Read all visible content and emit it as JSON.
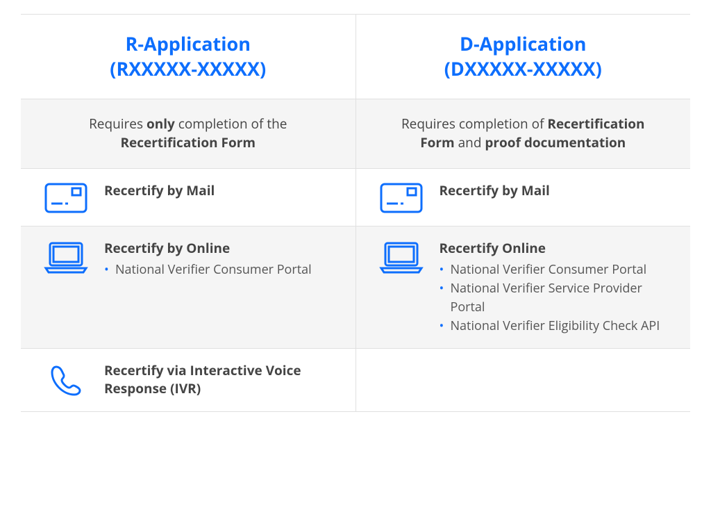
{
  "columns": {
    "left": {
      "title_line1": "R-Application",
      "title_line2": "(RXXXXX-XXXXX)",
      "desc_pre": "Requires ",
      "desc_bold1": "only",
      "desc_mid": " completion of the ",
      "desc_bold2": "Recertification Form",
      "desc_post": ""
    },
    "right": {
      "title_line1": "D-Application",
      "title_line2": "(DXXXXX-XXXXX)",
      "desc_pre": "Requires completion of ",
      "desc_bold1": "Recertification Form",
      "desc_mid": " and ",
      "desc_bold2": "proof documentation",
      "desc_post": ""
    }
  },
  "rows": [
    {
      "left": {
        "icon": "mail",
        "title": "Recertify by Mail",
        "items": []
      },
      "right": {
        "icon": "mail",
        "title": "Recertify by Mail",
        "items": []
      }
    },
    {
      "left": {
        "icon": "laptop",
        "title": "Recertify by Online",
        "items": [
          "National Verifier Consumer Portal"
        ]
      },
      "right": {
        "icon": "laptop",
        "title": "Recertify Online",
        "items": [
          "National Verifier Consumer Portal",
          "National Verifier Service Provider Portal",
          "National Verifier Eligibility Check API"
        ]
      }
    },
    {
      "left": {
        "icon": "phone",
        "title": "Recertify via Interactive Voice Response (IVR)",
        "items": []
      },
      "right": null
    }
  ],
  "colors": {
    "accent": "#0d6efd"
  }
}
